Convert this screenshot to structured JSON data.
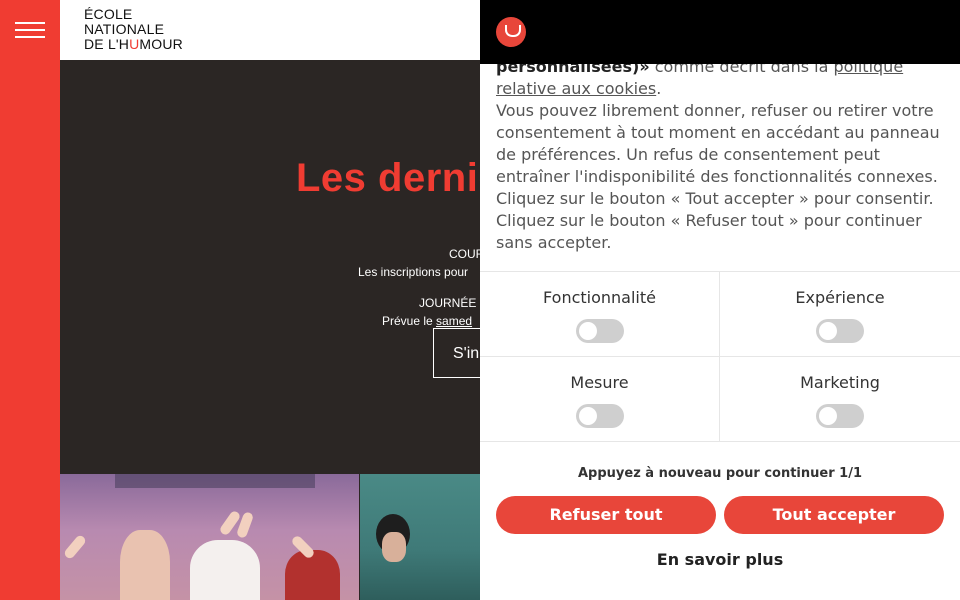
{
  "header": {
    "logo_lines": [
      "ÉCOLE",
      "NATIONALE",
      "DE L'H",
      "MOUR"
    ],
    "logo_u": "U"
  },
  "hero": {
    "title": "Les derniè",
    "line1": "COUR",
    "line2": "Les inscriptions pour",
    "line3": "JOURNÉE",
    "line4_prefix": "Prévue le ",
    "line4_link": "samed",
    "button": "S'in"
  },
  "cookie": {
    "text_bold": "personnalisées)»",
    "text_after_bold": " comme décrit dans la ",
    "policy_link": "politique relative aux cookies",
    "text_end": ".",
    "paragraph2": "Vous pouvez librement donner, refuser ou retirer votre consentement à tout moment en accédant au panneau de préférences. Un refus de consentement peut entraîner l'indisponibilité des fonctionnalités connexes. Cliquez sur le bouton « Tout accepter » pour consentir. Cliquez sur le bouton « Refuser tout » pour continuer sans accepter.",
    "categories": [
      {
        "label": "Fonctionnalité",
        "enabled": false
      },
      {
        "label": "Expérience",
        "enabled": false
      },
      {
        "label": "Mesure",
        "enabled": false
      },
      {
        "label": "Marketing",
        "enabled": false
      }
    ],
    "press_again": "Appuyez à nouveau pour continuer 1/1",
    "refuse_label": "Refuser tout",
    "accept_label": "Tout accepter",
    "more_label": "En savoir plus"
  },
  "colors": {
    "brand_red": "#f03c32",
    "button_red": "#e8463a",
    "hero_bg": "#2b2624"
  },
  "icons": [
    "hamburger-menu-icon",
    "cookie-consent-logo-icon"
  ]
}
